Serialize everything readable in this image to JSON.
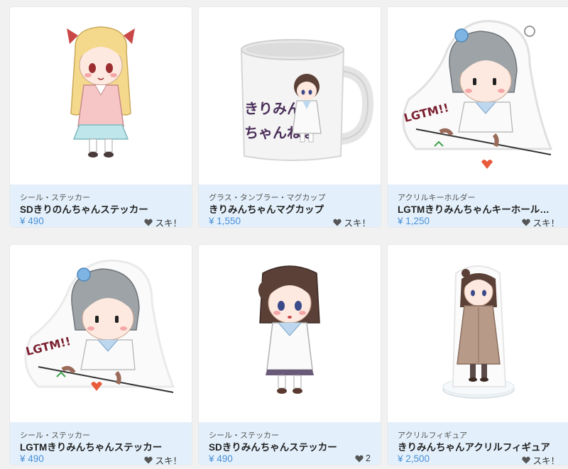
{
  "products": [
    {
      "category": "シール・ステッカー",
      "name": "SDきりのんちゃんステッカー",
      "price": "¥ 490",
      "like_label": "スキ！",
      "image_icon": "kirinon-sticker-image"
    },
    {
      "category": "グラス・タンブラー・マグカップ",
      "name": "きりみんちゃんマグカップ",
      "price": "¥ 1,550",
      "like_label": "スキ！",
      "image_icon": "mug-image",
      "mug_text_line1": "きりみん",
      "mug_text_line2": "ちゃんねる"
    },
    {
      "category": "アクリルキーホルダー",
      "name": "LGTMきりみんちゃんキーホールダ…",
      "price": "¥ 1,250",
      "like_label": "スキ！",
      "image_icon": "keyholder-image",
      "art_text": "LGTM!!"
    },
    {
      "category": "シール・ステッカー",
      "name": "LGTMきりみんちゃんステッカー",
      "price": "¥ 490",
      "like_label": "スキ！",
      "image_icon": "lgtm-sticker-image",
      "art_text": "LGTM!!"
    },
    {
      "category": "シール・ステッカー",
      "name": "SDきりみんちゃんステッカー",
      "price": "¥ 490",
      "like_label": "2",
      "image_icon": "kirimin-sticker-image"
    },
    {
      "category": "アクリルフィギュア",
      "name": "きりみんちゃんアクリルフィギュア",
      "price": "¥ 2,500",
      "like_label": "スキ！",
      "image_icon": "acrylic-figure-image"
    }
  ],
  "colors": {
    "price": "#4a8fd6",
    "info_bg": "#e3f0fb",
    "heart": "#555555"
  }
}
